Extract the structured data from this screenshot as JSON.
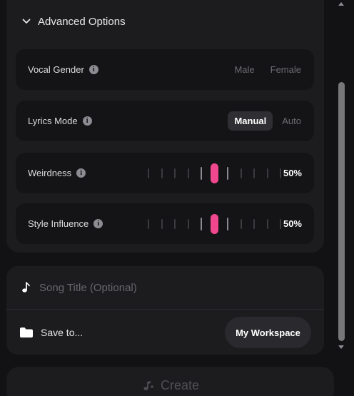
{
  "advanced": {
    "title": "Advanced Options",
    "vocal_gender": {
      "label": "Vocal Gender",
      "options": [
        "Male",
        "Female"
      ]
    },
    "lyrics_mode": {
      "label": "Lyrics Mode",
      "options": [
        "Manual",
        "Auto"
      ],
      "selected": "Manual"
    },
    "weirdness": {
      "label": "Weirdness",
      "value": "50%",
      "level": 0.5
    },
    "style_influence": {
      "label": "Style Influence",
      "value": "50%",
      "level": 0.5
    }
  },
  "song": {
    "title_placeholder": "Song Title (Optional)",
    "save_label": "Save to...",
    "workspace_label": "My Workspace"
  },
  "create": {
    "label": "Create"
  },
  "colors": {
    "accent": "#f0478f",
    "panel": "#1c1c1f",
    "row": "#141416",
    "background": "#121214"
  },
  "icons": [
    "chevron-down-icon",
    "info-icon",
    "music-note-icon",
    "folder-icon",
    "create-music-icon"
  ]
}
